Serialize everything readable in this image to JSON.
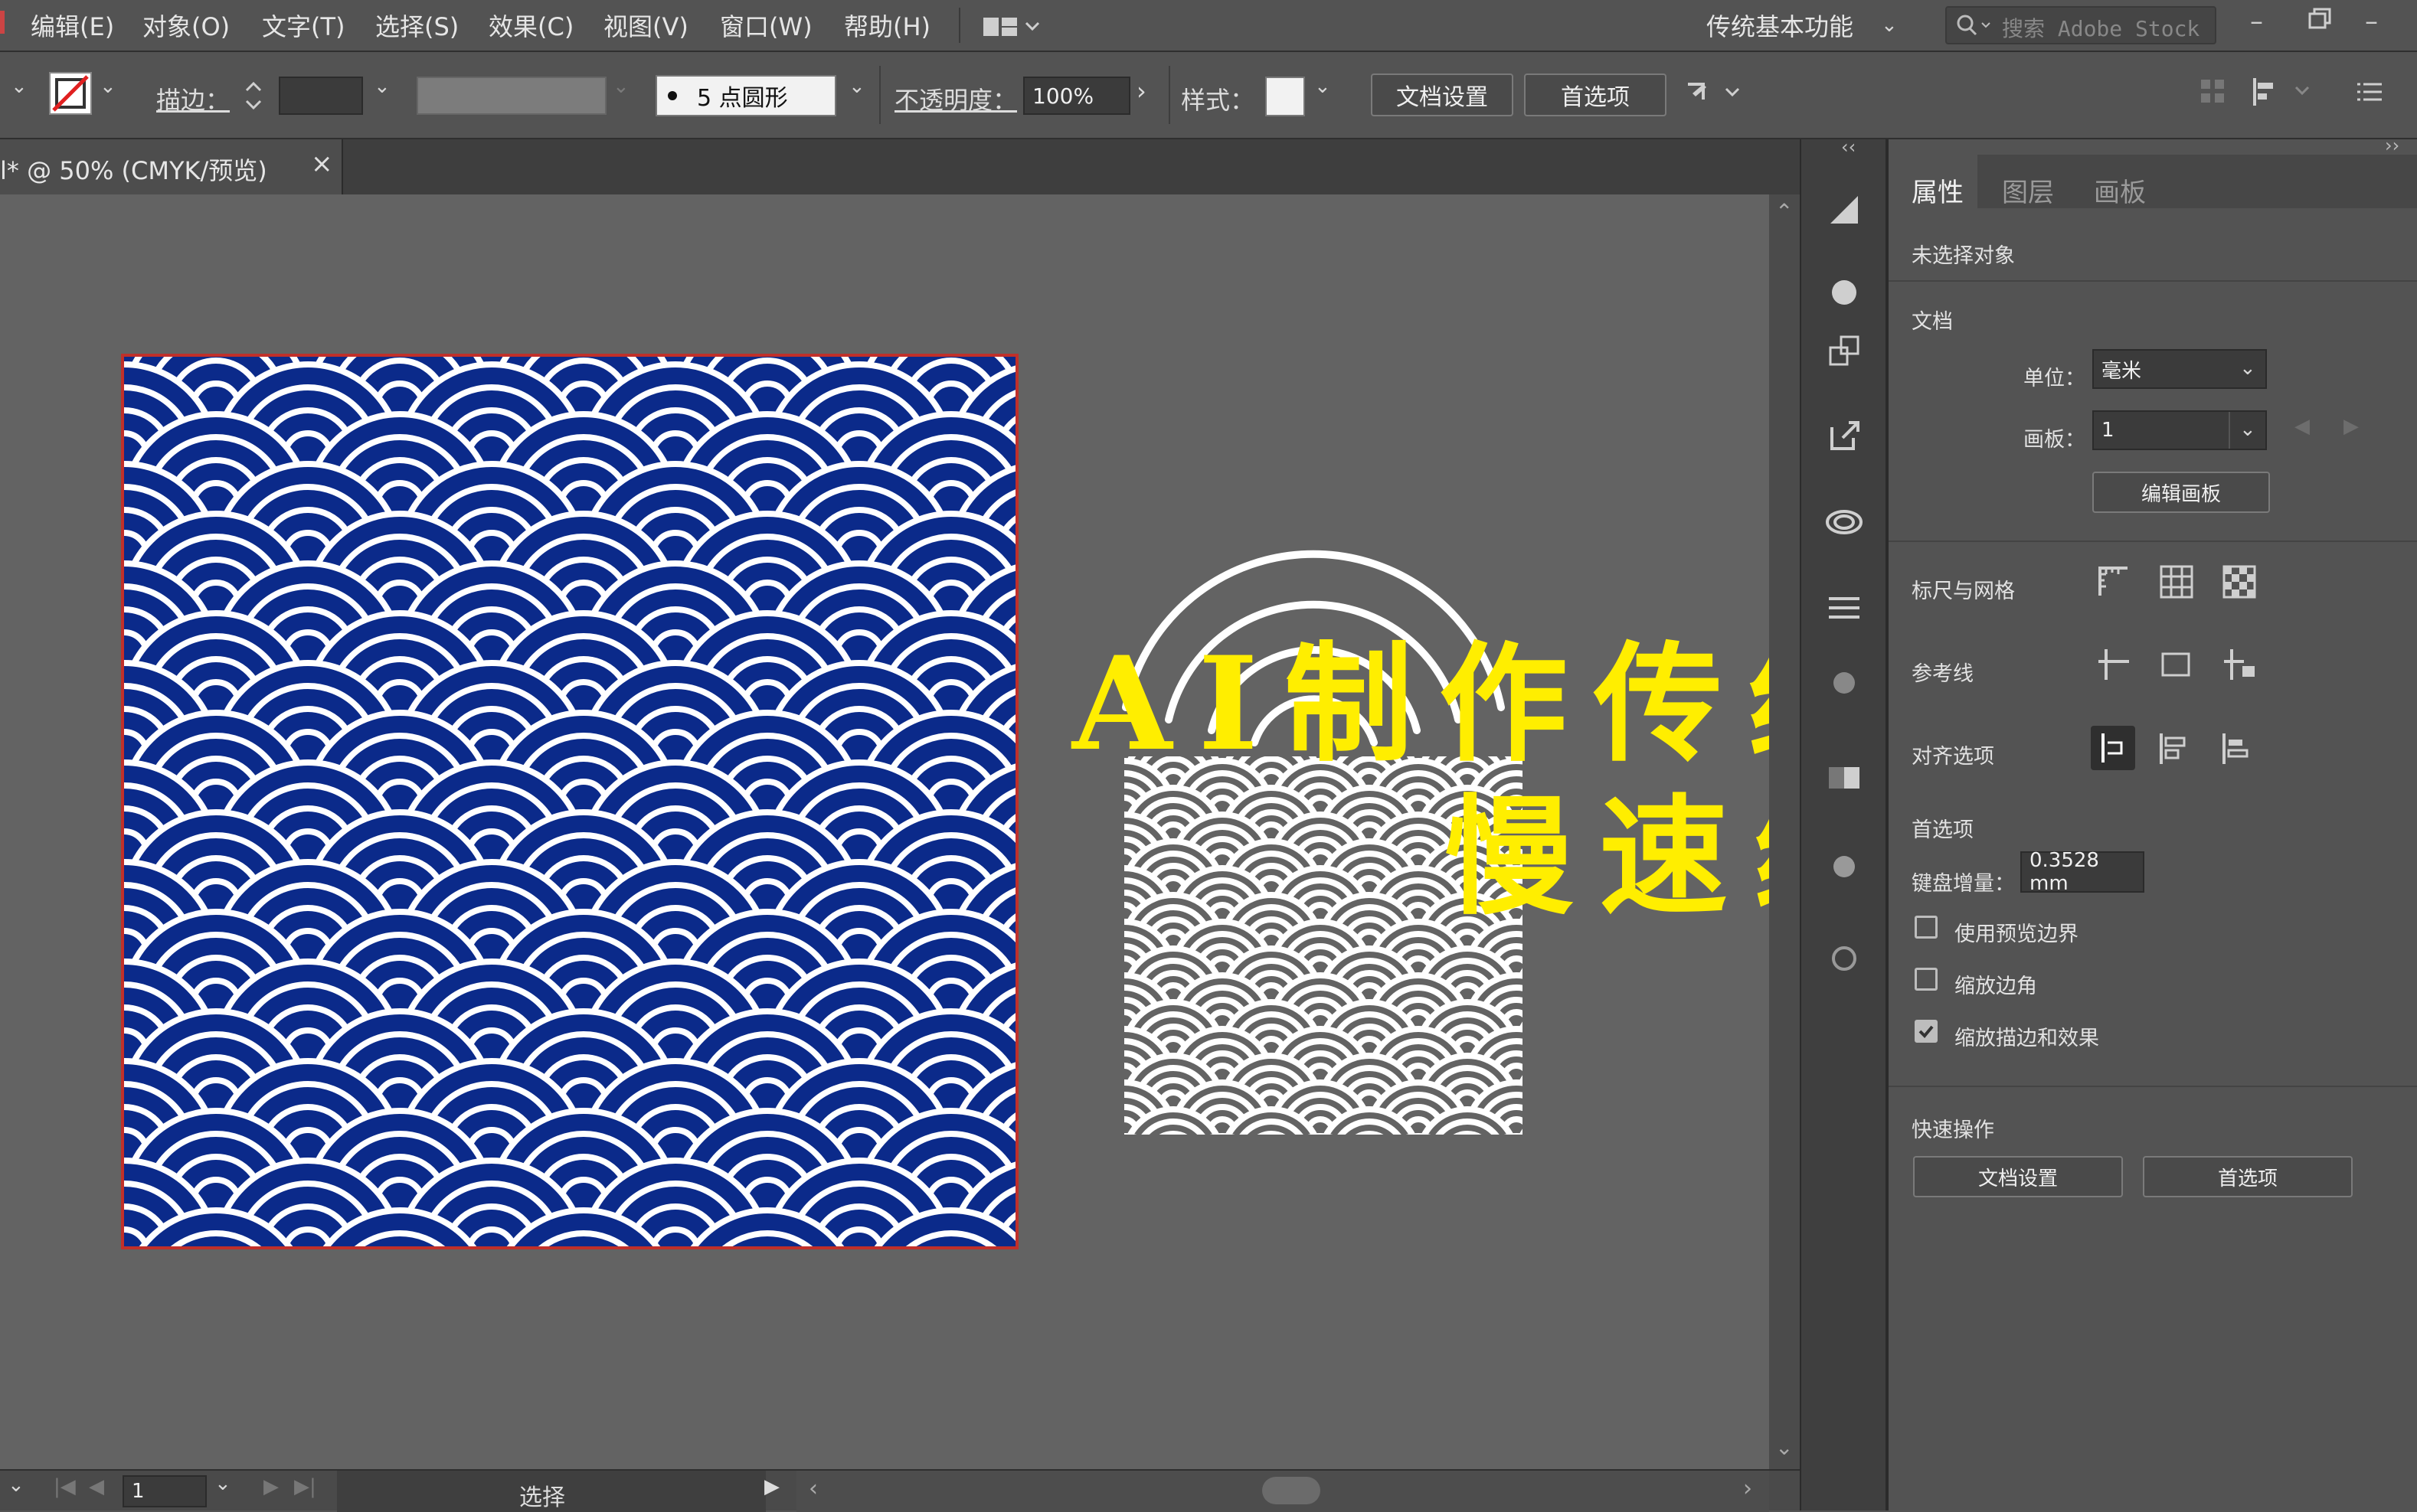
{
  "menu": [
    "编辑(E)",
    "对象(O)",
    "文字(T)",
    "选择(S)",
    "效果(C)",
    "视图(V)",
    "窗口(W)",
    "帮助(H)"
  ],
  "workspace": "传统基本功能",
  "search_placeholder": "搜索 Adobe Stock",
  "control": {
    "stroke_label": "描边：",
    "brush_value": "5 点圆形",
    "opacity_label": "不透明度：",
    "opacity_value": "100%",
    "style_label": "样式：",
    "doc_setup": "文档设置",
    "prefs": "首选项"
  },
  "doc_tab": {
    "title": "l* @ 50% (CMYK/预览)",
    "close": "×"
  },
  "panel": {
    "tabs": [
      "属性",
      "图层",
      "画板"
    ],
    "no_selection": "未选择对象",
    "document": "文档",
    "unit_label": "单位：",
    "unit_value": "毫米",
    "artboard_label": "画板：",
    "artboard_value": "1",
    "edit_artboards": "编辑画板",
    "rulers_grids": "标尺与网格",
    "guides": "参考线",
    "align_options": "对齐选项",
    "preferences": "首选项",
    "keyboard_increment_label": "键盘增量：",
    "keyboard_increment_value": "0.3528 mm",
    "checkboxes": [
      {
        "label": "使用预览边界",
        "checked": false
      },
      {
        "label": "缩放边角",
        "checked": false
      },
      {
        "label": "缩放描边和效果",
        "checked": true
      }
    ],
    "quick_actions": "快速操作",
    "qa_doc_setup": "文档设置",
    "qa_prefs": "首选项"
  },
  "status": {
    "page": "1",
    "mode": "选择"
  },
  "overlay": {
    "line1": "AI制作传统鱼纹图案",
    "line2": "慢速练手"
  },
  "colors": {
    "pattern_fill": "#0b2a8a",
    "artboard_border": "#c0302a",
    "overlay_text": "#ffee00"
  }
}
